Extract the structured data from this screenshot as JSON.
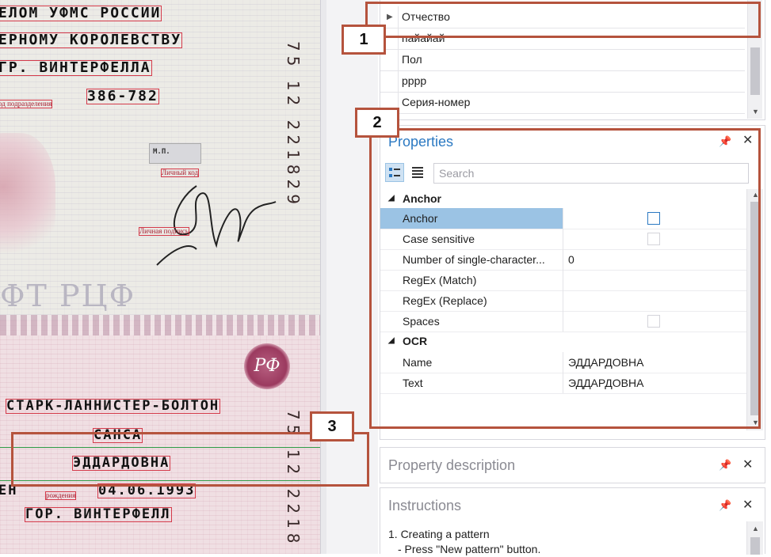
{
  "document": {
    "lines": {
      "issuer1": "ЕЛОМ УФМС РОССИИ",
      "issuer2": "ЕРНОМУ КОРОЛЕВСТВУ",
      "issuer3": "ГР. ВИНТЕРФЕЛЛА",
      "code_label": "од подразделения",
      "code": "386-782",
      "stamp_label": "Личный код",
      "signature_label": "Личная подпись",
      "watermark": "ФТ РЦФ",
      "surname": "СТАРК-ЛАННИСТЕР-БОЛТОН",
      "name": "САНСА",
      "patronymic": "ЭДДАРДОВНА",
      "birth_label": "рождения",
      "birth_date": "04.06.1993",
      "birth_prefix": "ЕН",
      "birthplace": "ГОР. ВИНТЕРФЕЛЛ",
      "stamp_code": "М.П.",
      "seal_text": "РФ"
    },
    "vertical_number_top": "75  12  221829",
    "vertical_number_bottom": "75  12  2218"
  },
  "callouts": [
    "1",
    "2",
    "3"
  ],
  "fields_list": {
    "rows": [
      "Отчество",
      "пайайай",
      "Пол",
      "pppp",
      "Серия-номер"
    ]
  },
  "properties": {
    "title": "Properties",
    "search_placeholder": "Search",
    "categories": [
      {
        "name": "Anchor",
        "rows": [
          {
            "name": "Anchor",
            "value": "",
            "checkbox": true,
            "selected": true
          },
          {
            "name": "Case sensitive",
            "value": "",
            "checkbox": true,
            "selected": false
          },
          {
            "name": "Number of single-character...",
            "value": "0",
            "checkbox": false,
            "selected": false
          },
          {
            "name": "RegEx (Match)",
            "value": "",
            "checkbox": false,
            "selected": false
          },
          {
            "name": "RegEx (Replace)",
            "value": "",
            "checkbox": false,
            "selected": false
          },
          {
            "name": "Spaces",
            "value": "",
            "checkbox": true,
            "selected": false
          }
        ]
      },
      {
        "name": "OCR",
        "rows": [
          {
            "name": "Name",
            "value": "ЭДДАРДОВНА",
            "checkbox": false,
            "selected": false
          },
          {
            "name": "Text",
            "value": "ЭДДАРДОВНА",
            "checkbox": false,
            "selected": false
          }
        ]
      }
    ]
  },
  "property_description": {
    "title": "Property description"
  },
  "instructions": {
    "title": "Instructions",
    "line1": "1. Creating a pattern",
    "line2": "- Press \"New pattern\" button."
  },
  "icons": {
    "pin": "pin-icon",
    "close": "close-icon",
    "expand": "expand-arrow-icon",
    "collapse": "collapse-triangle-icon",
    "categorized": "categorized-view-icon",
    "alphabetical": "alphabetical-view-icon"
  },
  "colors": {
    "accent": "#2b79c2",
    "callout": "#b5533d",
    "ocr_box": "#d43a4a",
    "selection": "#9bc3e4"
  }
}
